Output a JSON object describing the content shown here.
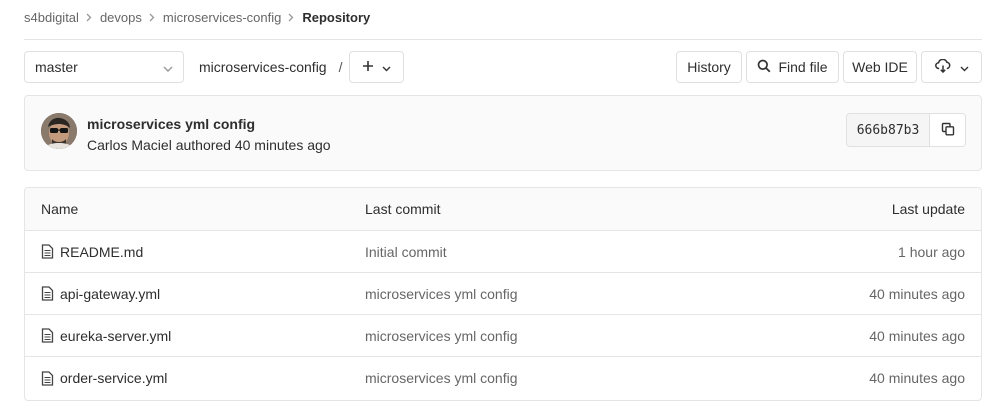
{
  "breadcrumb": {
    "items": [
      "s4bdigital",
      "devops",
      "microservices-config",
      "Repository"
    ]
  },
  "toolbar": {
    "branch": "master",
    "path": "microservices-config",
    "path_separator": "/",
    "history_label": "History",
    "find_file_label": "Find file",
    "web_ide_label": "Web IDE"
  },
  "last_commit": {
    "title": "microservices yml config",
    "author_line": "Carlos Maciel authored 40 minutes ago",
    "sha": "666b87b3"
  },
  "table": {
    "headers": {
      "name": "Name",
      "last_commit": "Last commit",
      "last_update": "Last update"
    },
    "rows": [
      {
        "name": "README.md",
        "commit": "Initial commit",
        "updated": "1 hour ago"
      },
      {
        "name": "api-gateway.yml",
        "commit": "microservices yml config",
        "updated": "40 minutes ago"
      },
      {
        "name": "eureka-server.yml",
        "commit": "microservices yml config",
        "updated": "40 minutes ago"
      },
      {
        "name": "order-service.yml",
        "commit": "microservices yml config",
        "updated": "40 minutes ago"
      }
    ]
  },
  "icons": {
    "breadcrumb_separator": "chevron-right-icon",
    "dropdown": "chevron-down-icon",
    "add": "plus-icon",
    "search": "search-icon",
    "download": "cloud-download-icon",
    "copy": "copy-icon",
    "file": "file-text-icon"
  },
  "colors": {
    "text": "#2e2e2e",
    "muted": "#666666",
    "border": "#e5e5e5",
    "panel_bg": "#fafafa"
  }
}
